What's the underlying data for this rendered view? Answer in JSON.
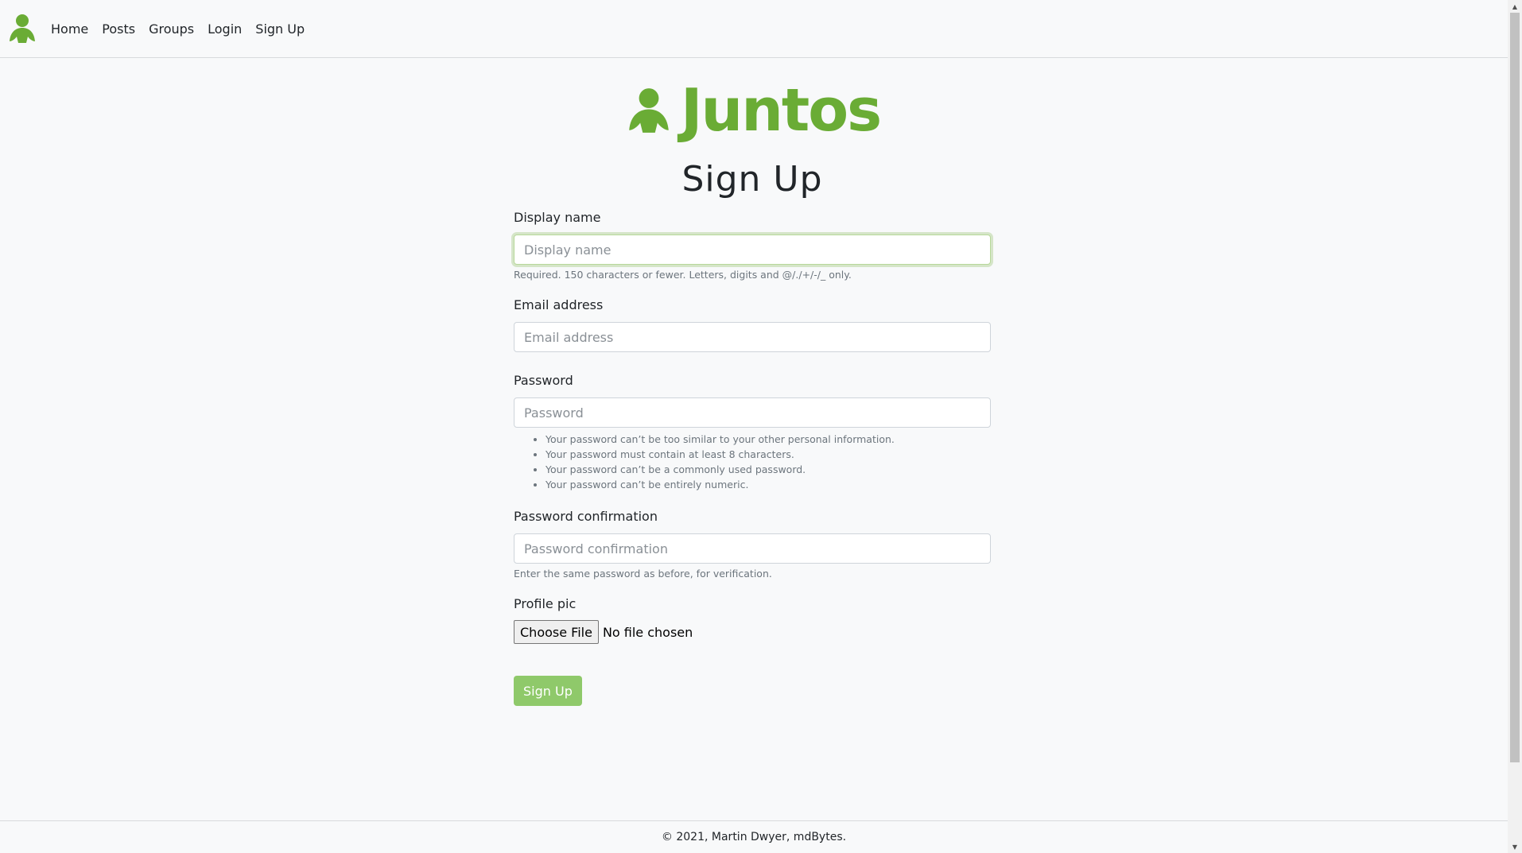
{
  "colors": {
    "brand_green": "#6aac35",
    "button_green": "#8fc96a",
    "background": "#f8f9fa"
  },
  "navbar": {
    "logo_icon": "person-icon",
    "links": [
      "Home",
      "Posts",
      "Groups",
      "Login",
      "Sign Up"
    ]
  },
  "brand": {
    "icon": "person-icon",
    "name": "Juntos"
  },
  "page": {
    "title": "Sign Up"
  },
  "form": {
    "display_name": {
      "label": "Display name",
      "placeholder": "Display name",
      "value": "",
      "help": "Required. 150 characters or fewer. Letters, digits and @/./+/-/_ only."
    },
    "email": {
      "label": "Email address",
      "placeholder": "Email address",
      "value": ""
    },
    "password": {
      "label": "Password",
      "placeholder": "Password",
      "value": "",
      "help_items": [
        "Your password can’t be too similar to your other personal information.",
        "Your password must contain at least 8 characters.",
        "Your password can’t be a commonly used password.",
        "Your password can’t be entirely numeric."
      ]
    },
    "password_confirmation": {
      "label": "Password confirmation",
      "placeholder": "Password confirmation",
      "value": "",
      "help": "Enter the same password as before, for verification."
    },
    "profile_pic": {
      "label": "Profile pic",
      "button_label": "Choose File",
      "status": "No file chosen"
    },
    "submit_label": "Sign Up"
  },
  "footer": {
    "text": "© 2021, Martin Dwyer, mdBytes."
  }
}
